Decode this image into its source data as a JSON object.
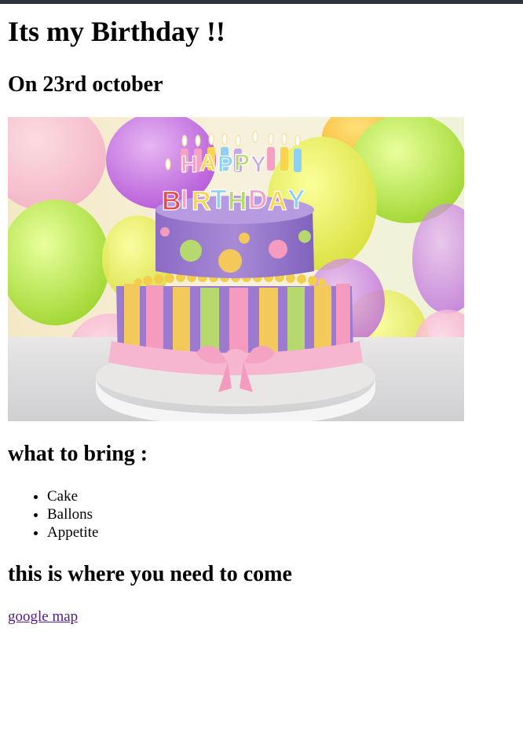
{
  "page": {
    "title": "Its my Birthday !!",
    "date": "On 23rd october",
    "bring_heading": "what to bring :",
    "bring_items": [
      "Cake",
      "Ballons",
      "Appetite"
    ],
    "where_heading": "this is where you need to come",
    "map_link": "google map"
  },
  "image": {
    "subject": "birthday-cake-photo",
    "cake_topper_text": "HAPPY BIRTHDAY"
  },
  "colors": {
    "topbar": "#2f3340",
    "link_visited": "#551a8b"
  }
}
